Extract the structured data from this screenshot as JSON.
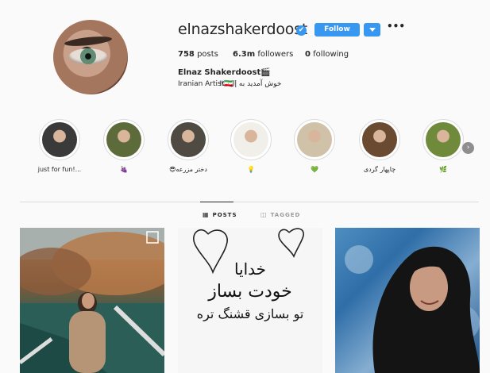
{
  "profile": {
    "username": "elnazshakerdoost",
    "verified_mark": "✔",
    "follow_label": "Follow",
    "more_label": "•••",
    "posts_count": "758",
    "posts_label": "posts",
    "followers_count": "6.3m",
    "followers_label": "followers",
    "following_count": "0",
    "following_label": "following",
    "full_name": "Elnaz Shakerdoost🎬",
    "bio_rtl": "خوش آمدید به إل😉!",
    "bio_ltr": "Iranian Artist🇮🇷",
    "accent_color": "#3897f0"
  },
  "highlights": [
    {
      "label": "just for fun!...",
      "color": "#3a3a3a"
    },
    {
      "label": "🍇",
      "color": "#5d6b3a"
    },
    {
      "label": "😎دختر مزرعه",
      "color": "#4f4b43"
    },
    {
      "label": "💡",
      "color": "#f1efe9"
    },
    {
      "label": "💚",
      "color": "#cfc2a8"
    },
    {
      "label": "چاپهار گردی",
      "color": "#6a4a30"
    },
    {
      "label": "🌿",
      "color": "#6f8a3a"
    }
  ],
  "tabs": {
    "posts": "POSTS",
    "tagged": "TAGGED"
  },
  "posts": [
    {
      "name": "post-lake-photo"
    },
    {
      "name": "post-calligraphy",
      "text_line1": "خدایا",
      "text_line2": "خودت بساز",
      "text_line3": "تو بسازی قشنگ تره"
    },
    {
      "name": "post-portrait-photo"
    }
  ]
}
